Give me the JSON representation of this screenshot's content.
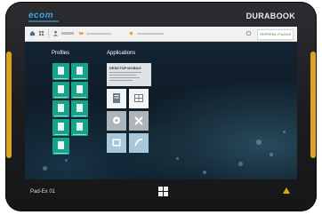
{
  "device": {
    "brand_left": "ecom",
    "brand_right": "DURABOOK",
    "model_label": "Pad-Ex 01"
  },
  "topbar": {
    "icons": [
      "home-icon",
      "grid-icon",
      "user-icon",
      "battery-icon",
      "wifi-icon",
      "sync-icon"
    ],
    "partner_logo": "PEPPERL+FUCHS"
  },
  "profiles": {
    "title": "Profiles"
  },
  "applications": {
    "title": "Applications",
    "wide_tile_title": "DESKTOP MOBILE"
  },
  "colors": {
    "bumper": "#e0a21a",
    "profile_tile": "#16a38a",
    "brand_ecom": "#3aa5e0"
  }
}
